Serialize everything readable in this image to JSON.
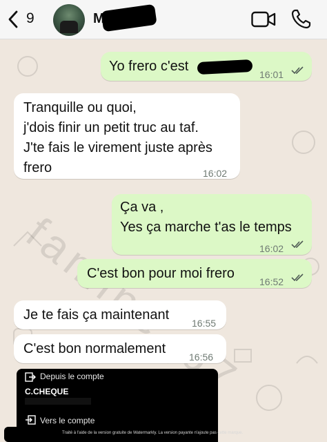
{
  "header": {
    "unread_count": "9",
    "contact_name": "M"
  },
  "messages": [
    {
      "dir": "out",
      "text": "Yo frero c'est",
      "time": "16:01"
    },
    {
      "dir": "in",
      "text": "Tranquille ou quoi,\nj'dois finir un petit truc au taf.\nJ'te fais le virement juste après\nfrero",
      "time": "16:02"
    },
    {
      "dir": "out",
      "text": "Ça va ,\nYes ça marche t'as le temps",
      "time": "16:02"
    },
    {
      "dir": "out",
      "text": "C'est bon pour moi frero",
      "time": "16:52"
    },
    {
      "dir": "in",
      "text": "Je te fais ça maintenant",
      "time": "16:55"
    },
    {
      "dir": "in",
      "text": "C'est bon normalement",
      "time": "16:56"
    }
  ],
  "watermark": "famine_67",
  "receipt": {
    "from_label": "Depuis le compte",
    "account_name": "C.CHEQUE",
    "to_label": "Vers le compte"
  },
  "footer_note": "Traité à l'aide de la version gratuite de Watermarkly. La version payante n'ajoute pas cette marque.",
  "colors": {
    "outgoing_bubble": "#dcf8c6",
    "incoming_bubble": "#ffffff",
    "chat_background": "#efe7de",
    "read_ticks": "#4f5b55"
  }
}
